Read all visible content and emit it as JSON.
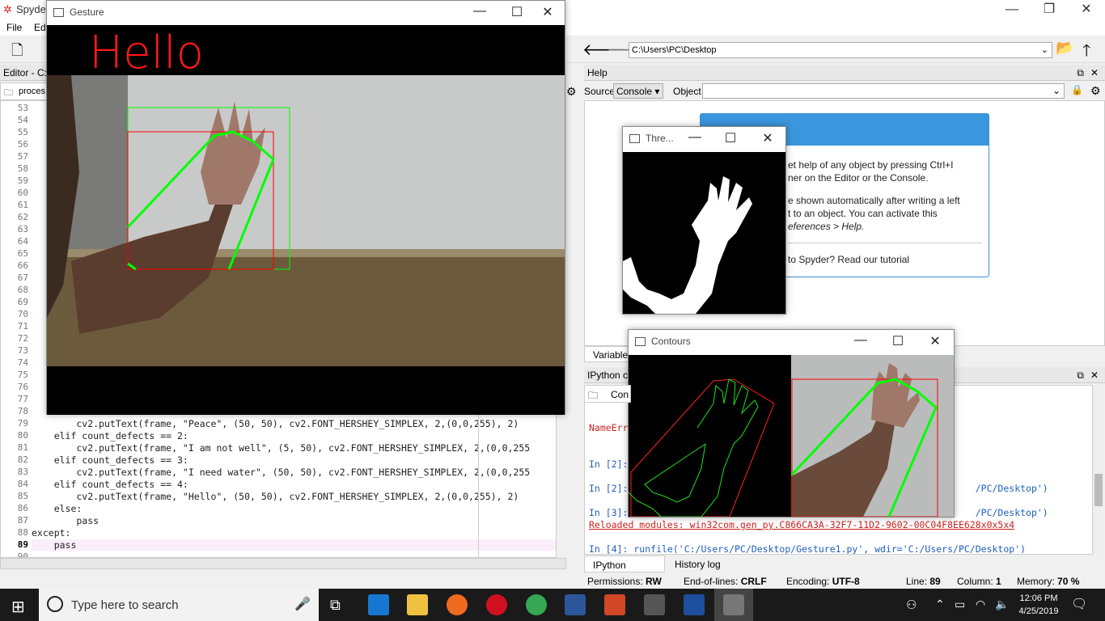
{
  "spyder": {
    "title": "Spyder",
    "menu": [
      "File",
      "Edi"
    ],
    "path": "C:\\Users\\PC\\Desktop"
  },
  "editor": {
    "pane_title": "Editor - C:\\",
    "tab": "proces",
    "line_numbers": [
      "53",
      "54",
      "55",
      "56",
      "57",
      "58",
      "59",
      "60",
      "61",
      "62",
      "63",
      "64",
      "65",
      "66",
      "67",
      "68",
      "69",
      "70",
      "71",
      "72",
      "73",
      "74",
      "75",
      "76",
      "77",
      "78",
      "79",
      "80",
      "81",
      "82",
      "83",
      "84",
      "85",
      "86",
      "87",
      "88",
      "89",
      "90"
    ],
    "code": [
      {
        "n": "79",
        "t": "        cv2.putText(frame, \"Peace\", (50, 50), cv2.FONT_HERSHEY_SIMPLEX, 2,(0,0,255), 2)"
      },
      {
        "n": "80",
        "t": "    elif count_defects == 2:"
      },
      {
        "n": "81",
        "t": "        cv2.putText(frame, \"I am not well\", (5, 50), cv2.FONT_HERSHEY_SIMPLEX, 2,(0,0,255"
      },
      {
        "n": "82",
        "t": "    elif count_defects == 3:"
      },
      {
        "n": "83",
        "t": "        cv2.putText(frame, \"I need water\", (50, 50), cv2.FONT_HERSHEY_SIMPLEX, 2,(0,0,255"
      },
      {
        "n": "84",
        "t": "    elif count_defects == 4:"
      },
      {
        "n": "85",
        "t": "        cv2.putText(frame, \"Hello\", (50, 50), cv2.FONT_HERSHEY_SIMPLEX, 2,(0,0,255), 2)"
      },
      {
        "n": "86",
        "t": "    else:"
      },
      {
        "n": "87",
        "t": "        pass"
      },
      {
        "n": "88",
        "t": "except:"
      },
      {
        "n": "89",
        "t": "    pass"
      }
    ]
  },
  "help": {
    "pane_title": "Help",
    "source_label": "Source",
    "source_value": "Console",
    "object_label": "Object",
    "lines": [
      "et help of any object by pressing Ctrl+I",
      "ner on the Editor or the Console.",
      "e shown automatically after writing a left",
      "t to an object. You can activate this",
      "eferences > Help.",
      "to Spyder? Read our tutorial"
    ],
    "variable_tab": "Variable e"
  },
  "console": {
    "pane_title": "IPython co",
    "tab": "Con",
    "lines": [
      "NameErr",
      "In [2]:",
      "In [2]:                                                              /PC/Desktop')",
      "In [3]:                                                              /PC/Desktop')",
      "Reloaded modules: win32com.gen_py.C866CA3A-32F7-11D2-9602-00C04F8EE628x0x5x4",
      "In [4]: runfile('C:/Users/PC/Desktop/Gesture1.py', wdir='C:/Users/PC/Desktop')"
    ],
    "tabs": [
      "IPython console",
      "History log"
    ]
  },
  "statusbar": {
    "permissions_label": "Permissions:",
    "permissions": "RW",
    "eol_label": "End-of-lines:",
    "eol": "CRLF",
    "encoding_label": "Encoding:",
    "encoding": "UTF-8",
    "line_label": "Line:",
    "line": "89",
    "column_label": "Column:",
    "column": "1",
    "memory_label": "Memory:",
    "memory": "70 %"
  },
  "gesture_window": {
    "title": "Gesture",
    "overlay_text": "Hello"
  },
  "threshold_window": {
    "title": "Thre..."
  },
  "contours_window": {
    "title": "Contours"
  },
  "taskbar": {
    "search_placeholder": "Type here to search",
    "time": "12:06 PM",
    "date": "4/25/2019"
  },
  "colors": {
    "accent": "#3a96dd",
    "overlay_red": "#ff0000",
    "hull_green": "#00ff00"
  }
}
